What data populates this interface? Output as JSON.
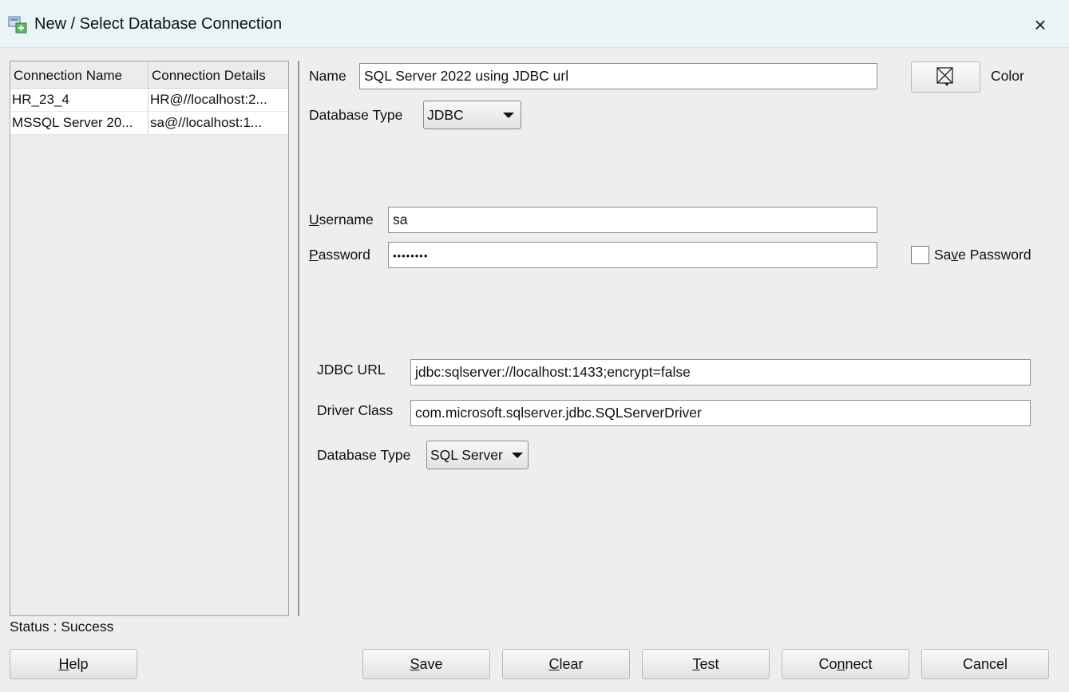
{
  "window": {
    "title": "New / Select Database Connection",
    "close_glyph": "×"
  },
  "connections": {
    "columns": [
      "Connection Name",
      "Connection Details"
    ],
    "rows": [
      {
        "name": "HR_23_4",
        "details": "HR@//localhost:2..."
      },
      {
        "name": "MSSQL Server 20...",
        "details": "sa@//localhost:1..."
      }
    ]
  },
  "form": {
    "name_label": "Name",
    "name_value": "SQL Server 2022 using JDBC url",
    "db_type_label": "Database Type",
    "db_type_value": "JDBC",
    "color_label": "Color",
    "username_label_mnemonic": "U",
    "username_label_rest": "sername",
    "username_value": "sa",
    "password_label_mnemonic": "P",
    "password_label_rest": "assword",
    "password_value": "••••••••",
    "save_password_pre": "Sa",
    "save_password_mnemonic": "v",
    "save_password_post": "e Password",
    "save_password_checked": false
  },
  "jdbc": {
    "url_label": "JDBC URL",
    "url_value": "jdbc:sqlserver://localhost:1433;encrypt=false",
    "driver_label": "Driver Class",
    "driver_value": "com.microsoft.sqlserver.jdbc.SQLServerDriver",
    "db_type_label": "Database Type",
    "db_type_value": "SQL Server"
  },
  "status": "Status : Success",
  "buttons": {
    "help": {
      "mnemonic": "H",
      "rest": "elp"
    },
    "save": {
      "mnemonic": "S",
      "rest": "ave"
    },
    "clear": {
      "mnemonic": "C",
      "rest": "lear"
    },
    "test": {
      "mnemonic": "T",
      "rest": "est"
    },
    "connect": {
      "pre": "Co",
      "mnemonic": "n",
      "rest": "nect"
    },
    "cancel": {
      "label": "Cancel"
    }
  },
  "icons": {
    "app": "database-connection-icon",
    "color_picker": "color-picker-icon",
    "close": "close-icon",
    "dropdown": "chevron-down-icon"
  }
}
